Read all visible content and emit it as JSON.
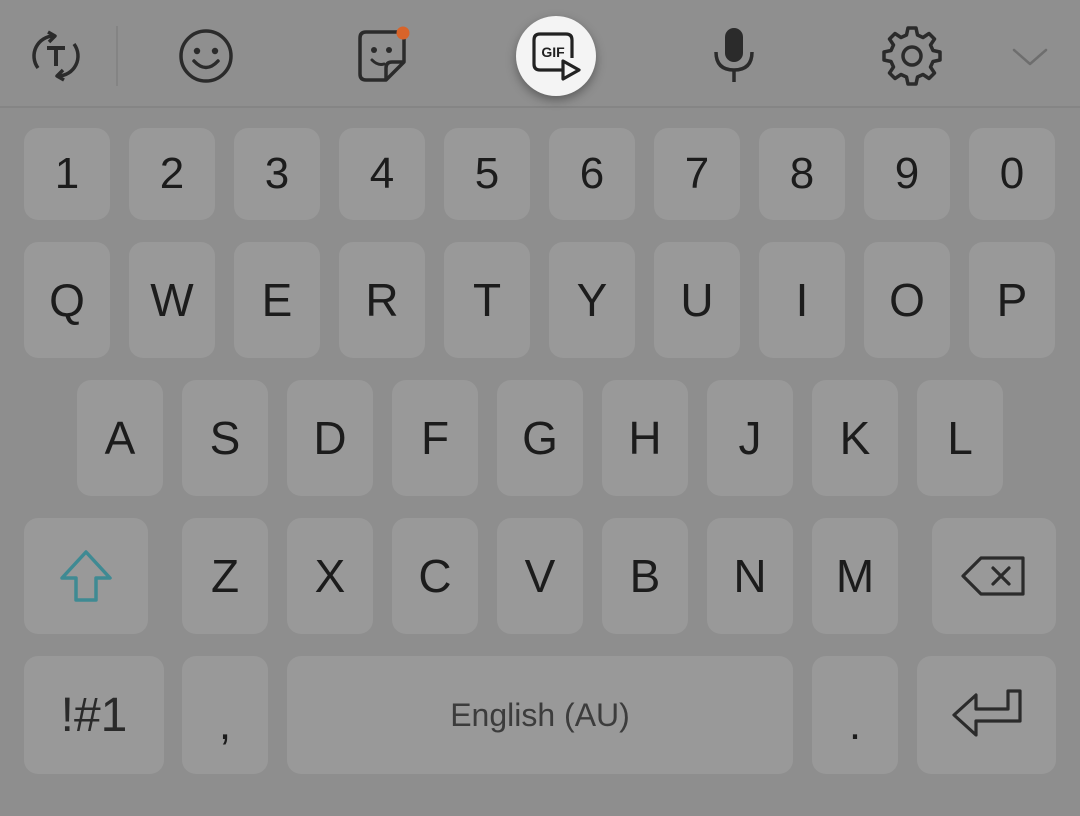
{
  "toolbar": {
    "icons": [
      "translate-icon",
      "emoji-icon",
      "sticker-icon",
      "gif-icon",
      "microphone-icon",
      "settings-icon",
      "chevron-down-icon"
    ],
    "gif_label": "GIF"
  },
  "keys": {
    "numbers": [
      "1",
      "2",
      "3",
      "4",
      "5",
      "6",
      "7",
      "8",
      "9",
      "0"
    ],
    "row1": [
      "Q",
      "W",
      "E",
      "R",
      "T",
      "Y",
      "U",
      "I",
      "O",
      "P"
    ],
    "row2": [
      "A",
      "S",
      "D",
      "F",
      "G",
      "H",
      "J",
      "K",
      "L"
    ],
    "row3": [
      "Z",
      "X",
      "C",
      "V",
      "B",
      "N",
      "M"
    ],
    "symbols": "!#1",
    "comma": ",",
    "space": "English (AU)",
    "period": "."
  },
  "colors": {
    "background": "#8e8e8e",
    "key": "#999999",
    "text": "#1c1c1c",
    "shift_accent": "#3f8a93",
    "notification_dot": "#d8642a",
    "gif_highlight": "#f4f4f4"
  }
}
